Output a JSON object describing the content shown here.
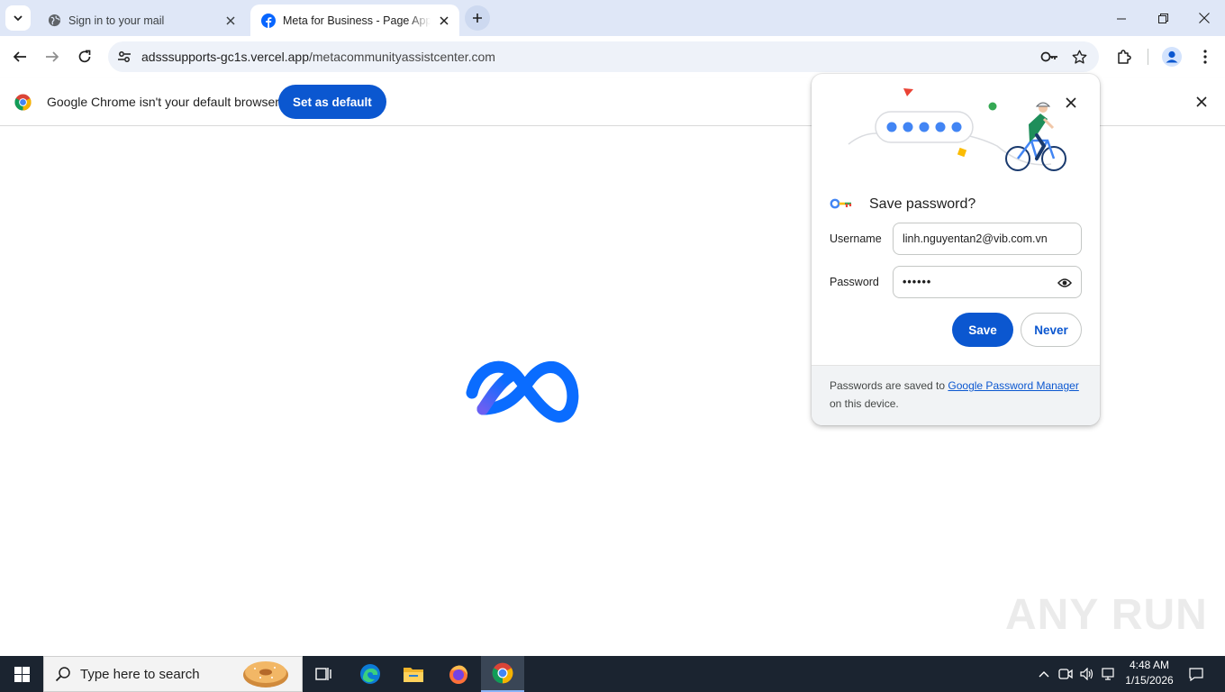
{
  "browser": {
    "tabs": [
      {
        "title": "Sign in to your mail",
        "favicon": "globe-icon",
        "active": false
      },
      {
        "title": "Meta for Business - Page Appeal",
        "favicon": "facebook-icon",
        "active": true
      }
    ],
    "address_bar": {
      "host": "adsssupports-gc1s.vercel.app",
      "path": "/metacommunityassistcenter.com"
    }
  },
  "infobar": {
    "message": "Google Chrome isn't your default browser",
    "button_label": "Set as default"
  },
  "password_bubble": {
    "title": "Save password?",
    "username_label": "Username",
    "username_value": "linh.nguyentan2@vib.com.vn",
    "password_label": "Password",
    "password_value": "••••••",
    "save_label": "Save",
    "never_label": "Never",
    "footer_prefix": "Passwords are saved to ",
    "footer_link": "Google Password Manager",
    "footer_suffix": "on this device."
  },
  "watermark": "ANY RUN",
  "taskbar": {
    "search_placeholder": "Type here to search",
    "time": "4:48 AM",
    "date": "1/15/2026",
    "pinned": [
      "task-view-icon",
      "edge-icon",
      "file-explorer-icon",
      "firefox-icon",
      "chrome-icon"
    ]
  },
  "colors": {
    "accent": "#0b57d0",
    "tabstrip": "#dfe7f7",
    "taskbar": "#1b2430",
    "meta_blue": "#0866ff"
  }
}
